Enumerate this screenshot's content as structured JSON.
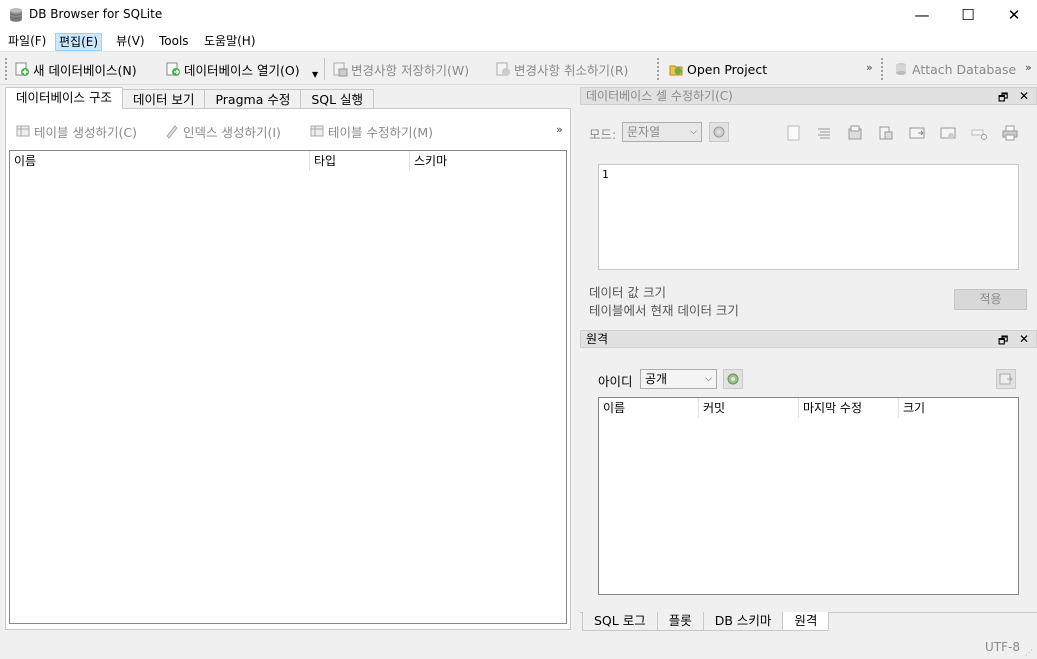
{
  "window": {
    "title": "DB Browser for SQLite",
    "minimize": "—",
    "maximize": "☐",
    "close": "✕"
  },
  "menu": [
    "파일(F)",
    "편집(E)",
    "뷰(V)",
    "Tools",
    "도움말(H)"
  ],
  "toolbar": {
    "new_db": "새 데이터베이스(N)",
    "open_db": "데이터베이스 열기(O)",
    "write_changes": "변경사항 저장하기(W)",
    "revert_changes": "변경사항 취소하기(R)",
    "open_project": "Open Project",
    "attach_db": "Attach Database",
    "overflow": "»"
  },
  "left": {
    "tabs": [
      "데이터베이스 구조",
      "데이터 보기",
      "Pragma 수정",
      "SQL 실행"
    ],
    "actions": {
      "create_table": "테이블 생성하기(C)",
      "create_index": "인덱스 생성하기(I)",
      "modify_table": "테이블 수정하기(M)",
      "overflow": "»"
    },
    "columns": [
      "이름",
      "타입",
      "스키마"
    ]
  },
  "edit_cell": {
    "title": "데이터베이스 셀 수정하기(C)",
    "mode_label": "모드:",
    "mode_value": "문자열",
    "content": "1",
    "size_label1": "데이터 값 크기",
    "size_label2": "테이블에서 현재 데이터 크기",
    "apply": "적용"
  },
  "remote": {
    "title": "원격",
    "id_label": "아이디",
    "id_value": "공개",
    "columns": [
      "이름",
      "커밋",
      "마지막 수정",
      "크기"
    ]
  },
  "bottom_tabs": [
    "SQL 로그",
    "플롯",
    "DB 스키마",
    "원격"
  ],
  "status": {
    "encoding": "UTF-8"
  },
  "dock_buttons": {
    "float": "🗗",
    "close": "✕"
  }
}
